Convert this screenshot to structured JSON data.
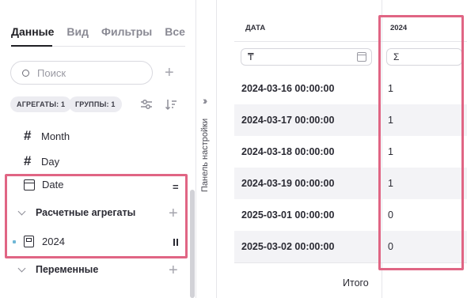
{
  "left_panel": {
    "tabs": [
      {
        "label": "Данные",
        "active": true
      },
      {
        "label": "Вид",
        "active": false
      },
      {
        "label": "Фильтры",
        "active": false
      },
      {
        "label": "Все",
        "active": false
      }
    ],
    "search": {
      "placeholder": "Поиск",
      "value": ""
    },
    "chips": {
      "aggregates": "АГРЕГАТЫ: 1",
      "groups": "ГРУППЫ: 1"
    },
    "fields": [
      {
        "label": "Month",
        "icon": "hash-icon"
      },
      {
        "label": "Day",
        "icon": "hash-icon"
      },
      {
        "label": "Date",
        "icon": "calendar-icon"
      }
    ],
    "sections": {
      "calculated": {
        "label": "Расчетные агрегаты",
        "items": [
          {
            "label": "2024",
            "icon": "calculator-icon"
          }
        ]
      },
      "variables": {
        "label": "Переменные"
      }
    }
  },
  "settings_panel": {
    "label": "Панель настройки"
  },
  "table": {
    "columns": [
      "ДАТА",
      "2024"
    ],
    "filter_symbols": {
      "date": "₸",
      "value": "Σ"
    },
    "rows": [
      {
        "date": "2024-03-16 00:00:00",
        "value": "1"
      },
      {
        "date": "2024-03-17 00:00:00",
        "value": "1"
      },
      {
        "date": "2024-03-18 00:00:00",
        "value": "1"
      },
      {
        "date": "2024-03-19 00:00:00",
        "value": "1"
      },
      {
        "date": "2025-03-01 00:00:00",
        "value": "0"
      },
      {
        "date": "2025-03-02 00:00:00",
        "value": "0"
      }
    ],
    "total_label": "Итого"
  },
  "colors": {
    "highlight": "#e06584",
    "text": "#2a2a33",
    "row_alt": "#f3f3f6"
  }
}
